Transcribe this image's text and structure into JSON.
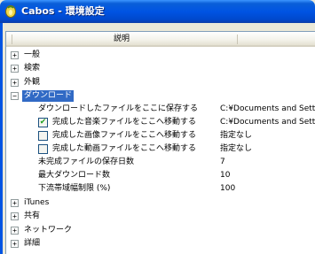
{
  "window": {
    "title": "Cabos - 環境設定"
  },
  "grid": {
    "header_label": "説明"
  },
  "rows": [
    {
      "label": "一般",
      "toggle": "+"
    },
    {
      "label": "検索",
      "toggle": "+"
    },
    {
      "label": "外観",
      "toggle": "+"
    },
    {
      "label": "ダウンロード",
      "toggle": "−",
      "selected": true
    },
    {
      "label": "ダウンロードしたファイルをここに保存する",
      "value": "C:¥Documents and Settings"
    },
    {
      "label": "完成した音楽ファイルをここへ移動する",
      "value": "C:¥Documents and Settings",
      "checked": true
    },
    {
      "label": "完成した画像ファイルをここへ移動する",
      "value": "指定なし",
      "checked": false
    },
    {
      "label": "完成した動画ファイルをここへ移動する",
      "value": "指定なし",
      "checked": false
    },
    {
      "label": "未完成ファイルの保存日数",
      "value": "7"
    },
    {
      "label": "最大ダウンロード数",
      "value": "10"
    },
    {
      "label": "下流帯域幅制限 (%)",
      "value": "100"
    },
    {
      "label": "iTunes",
      "toggle": "+"
    },
    {
      "label": "共有",
      "toggle": "+"
    },
    {
      "label": "ネットワーク",
      "toggle": "+"
    },
    {
      "label": "詳細",
      "toggle": "+"
    }
  ],
  "colors": {
    "titlebar": "#0054e3",
    "selection": "#316ac5",
    "check": "#21a121"
  }
}
